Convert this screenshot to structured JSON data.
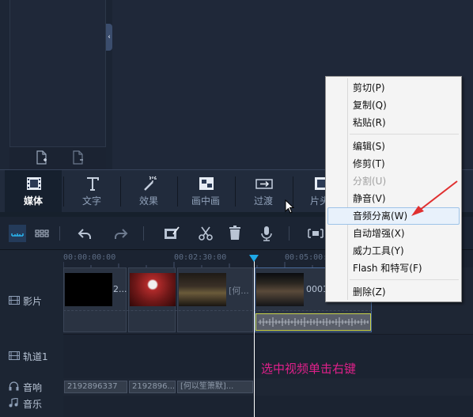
{
  "category_tabs": [
    {
      "label": "媒体",
      "icon": "film-icon"
    },
    {
      "label": "文字",
      "icon": "text-icon"
    },
    {
      "label": "效果",
      "icon": "magic-wand-icon"
    },
    {
      "label": "画中画",
      "icon": "picture-in-picture-icon"
    },
    {
      "label": "过渡",
      "icon": "transition-icon"
    },
    {
      "label": "片头/",
      "icon": "film-strip-icon"
    }
  ],
  "ruler": {
    "ticks": [
      "00:00:00:00",
      "00:02:30:00",
      "00:05:00:0"
    ]
  },
  "tracks": {
    "video": "影片",
    "overlay": "轨道1",
    "voice": "音响",
    "music": "音乐"
  },
  "video_clips": [
    {
      "name": "2..."
    },
    {
      "name": ""
    },
    {
      "name": "[何..."
    },
    {
      "name": "0001"
    }
  ],
  "audio_clips": [
    "2192896337",
    "2192896...",
    "[何以笙箫默]..."
  ],
  "annotation": "选中视频单击右键",
  "context_menu": {
    "items": [
      {
        "label": "剪切(P)",
        "enabled": true
      },
      {
        "label": "复制(Q)",
        "enabled": true
      },
      {
        "label": "粘贴(R)",
        "enabled": true
      },
      {
        "label": "编辑(S)",
        "enabled": true
      },
      {
        "label": "修剪(T)",
        "enabled": true
      },
      {
        "label": "分割(U)",
        "enabled": false
      },
      {
        "label": "静音(V)",
        "enabled": true
      },
      {
        "label": "音频分离(W)",
        "enabled": true,
        "highlighted": true
      },
      {
        "label": "自动增强(X)",
        "enabled": true
      },
      {
        "label": "威力工具(Y)",
        "enabled": true
      },
      {
        "label": "Flash 和特写(F)",
        "enabled": true
      },
      {
        "label": "删除(Z)",
        "enabled": true
      }
    ]
  },
  "colors": {
    "accent": "#1fa9e8",
    "annotation": "#e0208a",
    "arrow": "#e03030",
    "waveform_border": "#c8d24a"
  }
}
